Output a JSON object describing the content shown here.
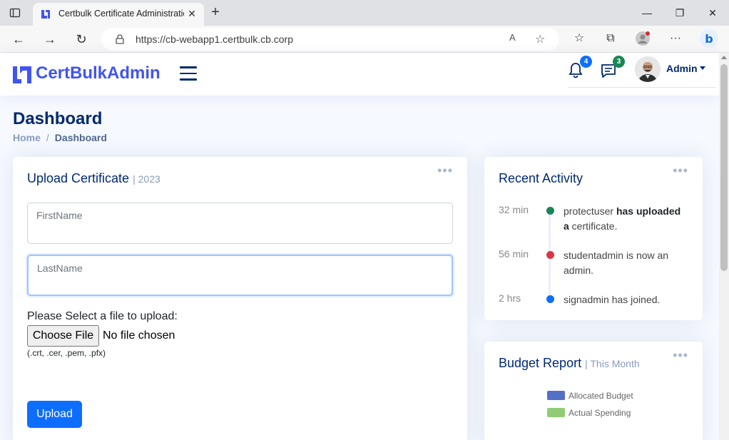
{
  "browser": {
    "tab_title": "Certbulk Certificate Administratic",
    "url": "https://cb-webapp1.certbulk.cb.corp"
  },
  "header": {
    "logo_text": "CertBulkAdmin",
    "notifications_count": "4",
    "messages_count": "3",
    "user_name": "Admin"
  },
  "page": {
    "title": "Dashboard",
    "breadcrumb": {
      "home": "Home",
      "separator": "/",
      "current": "Dashboard"
    }
  },
  "upload_card": {
    "title": "Upload Certificate",
    "subtitle": "| 2023",
    "firstname_placeholder": "FirstName",
    "lastname_placeholder": "LastName",
    "file_label": "Please Select a file to upload:",
    "choose_file_label": "Choose File",
    "no_file_text": "No file chosen",
    "file_hint": "(.crt, .cer, .pem, .pfx)",
    "upload_label": "Upload"
  },
  "activity_card": {
    "title": "Recent Activity",
    "items": [
      {
        "time": "32 min",
        "text_pre": "protectuser ",
        "text_bold": "has uploaded a",
        "text_post": " certificate.",
        "color": "#198754"
      },
      {
        "time": "56 min",
        "text_pre": "studentadmin is now an admin.",
        "text_bold": "",
        "text_post": "",
        "color": "#dc3545"
      },
      {
        "time": "2 hrs",
        "text_pre": "signadmin has joined.",
        "text_bold": "",
        "text_post": "",
        "color": "#0d6efd"
      }
    ]
  },
  "budget_card": {
    "title": "Budget Report",
    "subtitle": "| This Month",
    "legend": [
      {
        "label": "Allocated Budget",
        "color": "#5470c6"
      },
      {
        "label": "Actual Spending",
        "color": "#91cc75"
      }
    ]
  },
  "colors": {
    "brand": "#4154f1",
    "primary": "#0d6efd",
    "heading": "#012970",
    "notif_badge": "#0d6efd",
    "msg_badge": "#198754"
  }
}
